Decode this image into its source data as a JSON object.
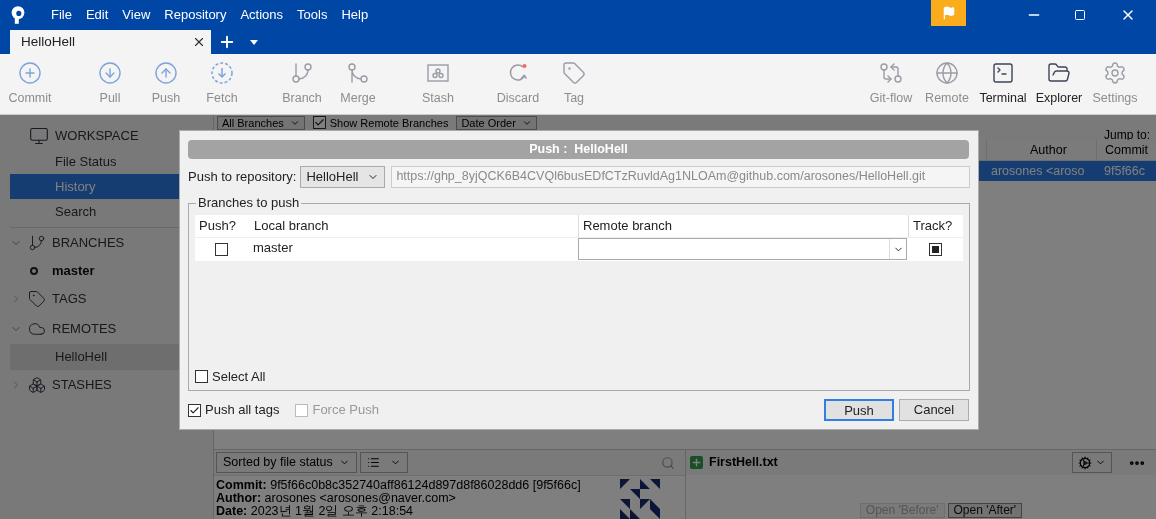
{
  "menu": [
    "File",
    "Edit",
    "View",
    "Repository",
    "Actions",
    "Tools",
    "Help"
  ],
  "tabs": [
    {
      "label": "HelloHell",
      "selected": true
    }
  ],
  "toolbar_left": [
    [
      {
        "label": "Commit",
        "disabled": true
      }
    ],
    [
      {
        "label": "Pull",
        "disabled": true
      },
      {
        "label": "Push",
        "disabled": true
      },
      {
        "label": "Fetch",
        "disabled": true
      }
    ],
    [
      {
        "label": "Branch",
        "disabled": true
      },
      {
        "label": "Merge",
        "disabled": true
      }
    ],
    [
      {
        "label": "Stash",
        "disabled": true
      }
    ],
    [
      {
        "label": "Discard",
        "disabled": true
      },
      {
        "label": "Tag",
        "disabled": true
      }
    ]
  ],
  "toolbar_right": [
    {
      "label": "Git-flow",
      "disabled": true
    },
    {
      "label": "Remote",
      "disabled": true
    },
    {
      "label": "Terminal",
      "disabled": false
    },
    {
      "label": "Explorer",
      "disabled": false
    },
    {
      "label": "Settings",
      "disabled": true
    }
  ],
  "sidebar": {
    "workspace": {
      "title": "WORKSPACE",
      "items": [
        {
          "label": "File Status",
          "selected": false
        },
        {
          "label": "History",
          "selected": true
        },
        {
          "label": "Search",
          "selected": false
        }
      ]
    },
    "sections": [
      {
        "title": "BRANCHES",
        "expanded": true,
        "items": [
          {
            "label": "master",
            "current": true
          }
        ]
      },
      {
        "title": "TAGS",
        "expanded": false
      },
      {
        "title": "REMOTES",
        "expanded": true,
        "items": [
          {
            "label": "HelloHell",
            "current": false,
            "selected": true
          }
        ]
      },
      {
        "title": "STASHES",
        "expanded": false
      }
    ]
  },
  "filter_bar": {
    "branches": "All Branches",
    "show_remote": {
      "label": "Show Remote Branches",
      "checked": true
    },
    "order": "Date Order",
    "jump_to": "Jump to:"
  },
  "history": {
    "columns": [
      "Author",
      "Commit"
    ],
    "rows": [
      {
        "author": "arosones <aroso",
        "commit": "9f5f66c",
        "selected": true
      }
    ]
  },
  "file_panel": {
    "sort": "Sorted by file status"
  },
  "commit_info": [
    {
      "label": "Commit:",
      "value": "9f5f66c0b8c352740aff86124d897d8f86028dd6 [9f5f66c]"
    },
    {
      "label": "Author:",
      "value": "arosones <arosones@naver.com>"
    },
    {
      "label": "Date:",
      "value": "2023년 1월 2일 오후 2:18:54"
    }
  ],
  "diff_panel": {
    "file": "FirstHell.txt",
    "buttons": [
      {
        "label": "Open 'Before'",
        "disabled": true
      },
      {
        "label": "Open 'After'",
        "disabled": false
      }
    ]
  },
  "dialog": {
    "title": "Push :  HelloHell",
    "repo_label": "Push to repository:",
    "repo": "HelloHell",
    "url": "https://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@github.com/arosones/HelloHell.git",
    "group_title": "Branches to push",
    "columns": [
      "Push?",
      "Local branch",
      "Remote branch",
      "Track?"
    ],
    "rows": [
      {
        "push": false,
        "local": "master",
        "track": true
      }
    ],
    "select_all": {
      "label": "Select All",
      "checked": false
    },
    "push_all_tags": {
      "label": "Push all tags",
      "checked": true,
      "disabled": false
    },
    "force_push": {
      "label": "Force Push",
      "checked": false,
      "disabled": true
    },
    "buttons": [
      {
        "label": "Push",
        "default": true
      },
      {
        "label": "Cancel",
        "default": false
      }
    ]
  }
}
